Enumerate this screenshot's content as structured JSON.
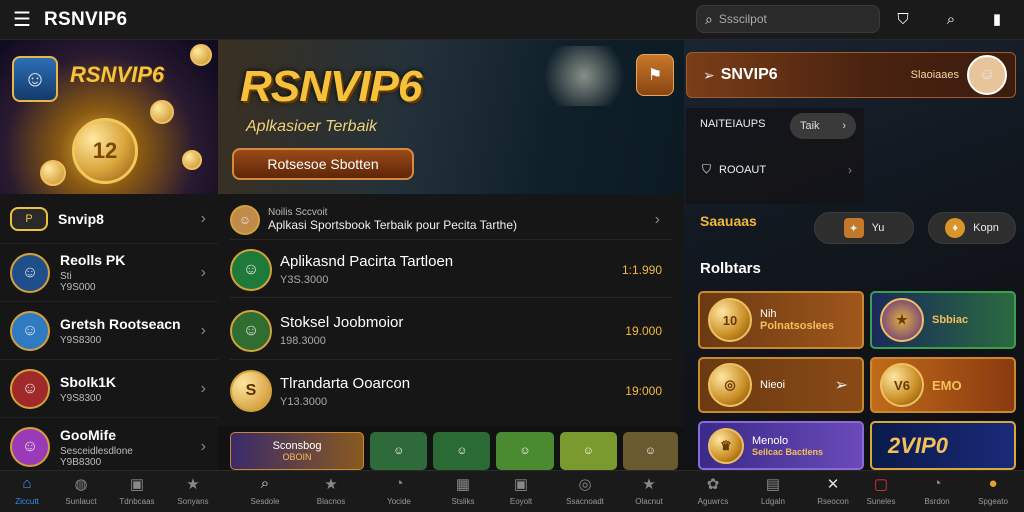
{
  "header": {
    "brand": "RSNVIP6",
    "search_placeholder": "Ssscilpot",
    "icons": [
      "menu-icon",
      "search-icon",
      "shield-icon",
      "zoom-icon",
      "mobile-icon"
    ]
  },
  "left": {
    "hero_logo": "RSNVIP6",
    "hero_coin": "12",
    "items": [
      {
        "title": "Snvip8",
        "line1": "",
        "line2": ""
      },
      {
        "title": "Reolls PK",
        "line1": "Sti",
        "line2": "Y9S000"
      },
      {
        "title": "Gretsh Rootseacn",
        "line1": "Y9S8300",
        "line2": ""
      },
      {
        "title": "Sbolk1K",
        "line1": "Y9S8300",
        "line2": ""
      },
      {
        "title": "GooMife",
        "line1": "Sesceidlesdlone",
        "line2": "Y9B8300"
      }
    ]
  },
  "hero": {
    "title": "RSNVIP6",
    "subtitle": "Aplkasioer Terbaik",
    "cta": "Rotsesoe Sbotten"
  },
  "middle": {
    "first": {
      "small": "Noilis Sccvoit",
      "line": "Aplkasi Sportsbook Terbaik pour Pecita Tarthe)"
    },
    "rows": [
      {
        "title": "Aplikasnd Pacirta Tartloen",
        "meta": "Y3S.3000",
        "value": "1:1.990"
      },
      {
        "title": "Stoksel Joobmoior",
        "meta": "198.3000",
        "value": "19.000"
      },
      {
        "title": "Tlrandarta Ooarcon",
        "meta": "Y13.3000",
        "value": "19:000"
      }
    ],
    "thumb_label": "Sconsbog",
    "thumb_sub": "OBOIN"
  },
  "right": {
    "header_name": "SNVIP6",
    "header_small": "Slaoiaaes",
    "row1_label": "NAITEIAUPS",
    "row1_pill": "Taik",
    "row2_label": "ROOAUT",
    "gold_label": "Saauaas",
    "btn1": "Yu",
    "btn2": "Kopn",
    "section": "Rolbtars",
    "cards": [
      {
        "num": "10",
        "t1": "Nih",
        "t2": "Polnatsoslees"
      },
      {
        "num": "",
        "t1": "",
        "t2": "Sbbiac"
      },
      {
        "num": "",
        "t1": "Nieoi",
        "t2": ""
      },
      {
        "num": "V6",
        "t1": "",
        "t2": "EMO"
      },
      {
        "num": "",
        "t1": "Menolo",
        "t2": "Seilcac Bactlens"
      },
      {
        "num": "",
        "t1": "",
        "t2": "2VIP0"
      }
    ]
  },
  "bottom_nav": [
    {
      "label": "Ziccutt",
      "icon": "home-icon",
      "active": true
    },
    {
      "label": "Sunlauct",
      "icon": "chat-icon",
      "active": false
    },
    {
      "label": "Tdnbcaas",
      "icon": "bag-icon",
      "active": false
    },
    {
      "label": "Sonyans",
      "icon": "star-icon",
      "active": false
    },
    {
      "label": "Sesdole",
      "icon": "search-icon",
      "active": false
    },
    {
      "label": "Blacnos",
      "icon": "star-icon",
      "active": false
    },
    {
      "label": "Yocide",
      "icon": "clock-icon",
      "active": false
    },
    {
      "label": "Stsliks",
      "icon": "grid-icon",
      "active": false
    },
    {
      "label": "Eoyolt",
      "icon": "bag-icon",
      "active": false
    },
    {
      "label": "Ssacnoadt",
      "icon": "target-icon",
      "active": false
    },
    {
      "label": "Olacnut",
      "icon": "star-icon",
      "active": false
    },
    {
      "label": "Aguwrcs",
      "icon": "gift-icon",
      "active": false
    },
    {
      "label": "Ldgaln",
      "icon": "list-icon",
      "active": false
    },
    {
      "label": "Rseocon",
      "icon": "cross-icon",
      "active": false
    },
    {
      "label": "Suneles",
      "icon": "alert-icon",
      "active": false
    },
    {
      "label": "Bsrdon",
      "icon": "clock-icon",
      "active": false
    },
    {
      "label": "Spgeato",
      "icon": "user-icon",
      "active": false
    }
  ],
  "colors": {
    "accent": "#3b8df0",
    "gold": "#f2b73a",
    "bg": "#121212"
  }
}
